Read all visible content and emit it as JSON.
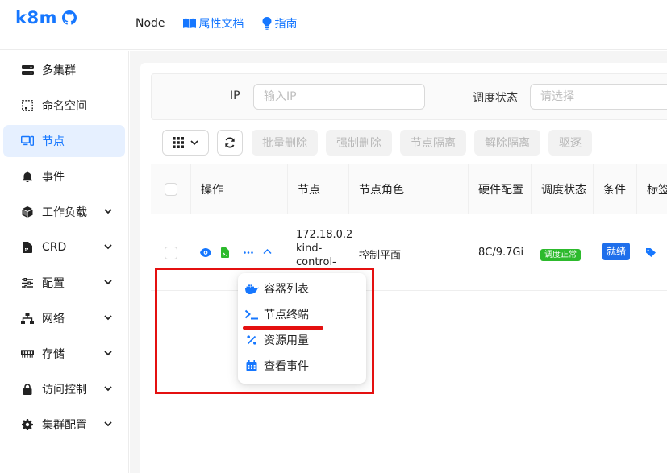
{
  "header": {
    "logo": "k8m",
    "nav": {
      "node": "Node",
      "docs": "属性文档",
      "guide": "指南"
    }
  },
  "sidebar": {
    "items": [
      {
        "label": "多集群",
        "icon": "server-icon",
        "expandable": false
      },
      {
        "label": "命名空间",
        "icon": "namespace-icon",
        "expandable": false
      },
      {
        "label": "节点",
        "icon": "node-icon",
        "expandable": false,
        "active": true
      },
      {
        "label": "事件",
        "icon": "bell-icon",
        "expandable": false
      },
      {
        "label": "工作负载",
        "icon": "cube-icon",
        "expandable": true
      },
      {
        "label": "CRD",
        "icon": "file-icon",
        "expandable": true
      },
      {
        "label": "配置",
        "icon": "sliders-icon",
        "expandable": true
      },
      {
        "label": "网络",
        "icon": "network-icon",
        "expandable": true
      },
      {
        "label": "存储",
        "icon": "memory-icon",
        "expandable": true
      },
      {
        "label": "访问控制",
        "icon": "lock-icon",
        "expandable": true
      },
      {
        "label": "集群配置",
        "icon": "gear-icon",
        "expandable": true
      }
    ]
  },
  "filters": {
    "ip_label": "IP",
    "ip_placeholder": "输入IP",
    "status_label": "调度状态",
    "status_placeholder": "请选择"
  },
  "toolbar": {
    "batch_delete": "批量删除",
    "force_delete": "强制删除",
    "cordon": "节点隔离",
    "uncordon": "解除隔离",
    "drain": "驱逐"
  },
  "table": {
    "columns": [
      "操作",
      "节点",
      "节点角色",
      "硬件配置",
      "调度状态",
      "条件",
      "标签"
    ],
    "row": {
      "node_lines": [
        "172.18.0.2",
        "kind-",
        "control-"
      ],
      "role": "控制平面",
      "hardware": "8C/9.7Gi",
      "schedule_status": "调度正常",
      "condition": "就绪"
    }
  },
  "dropdown": {
    "items": [
      {
        "label": "容器列表",
        "icon": "docker-icon"
      },
      {
        "label": "节点终端",
        "icon": "terminal-icon"
      },
      {
        "label": "资源用量",
        "icon": "percent-icon"
      },
      {
        "label": "查看事件",
        "icon": "calendar-icon"
      }
    ]
  },
  "colors": {
    "accent": "#1677ff",
    "active_bg": "#e6f0ff",
    "status_green": "#2dba2d",
    "condition_blue": "#1f6feb",
    "highlight_red": "#e41010"
  }
}
